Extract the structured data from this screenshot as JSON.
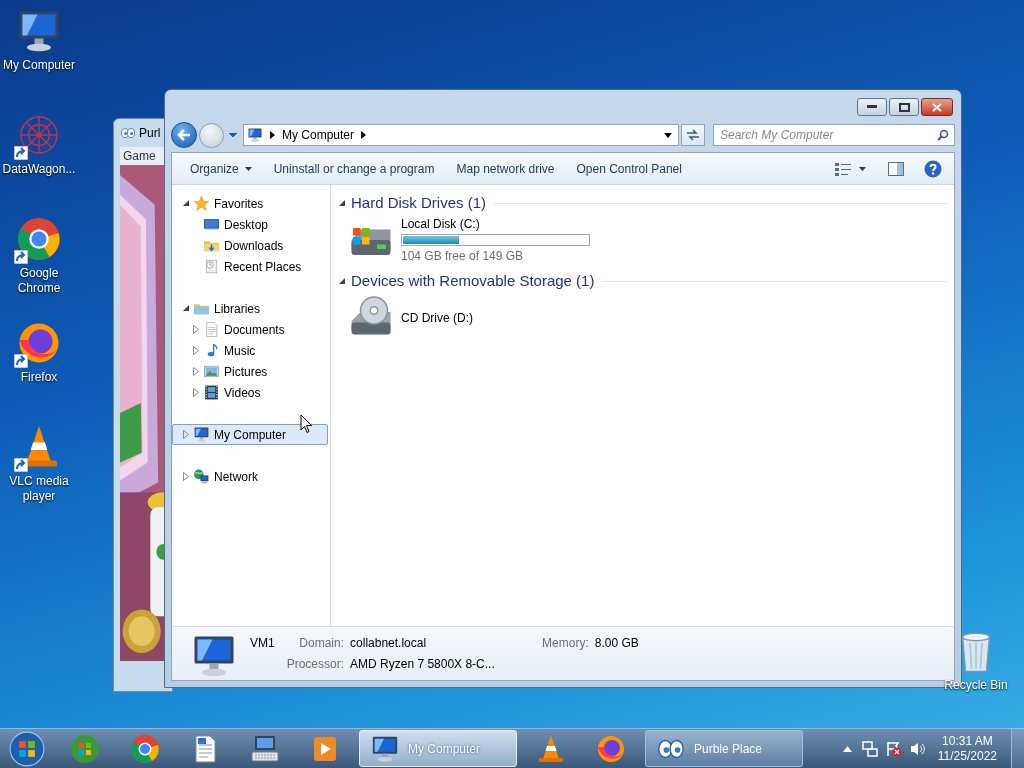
{
  "desktop_icons": [
    {
      "label": "My Computer",
      "kind": "computer",
      "shortcut": false
    },
    {
      "label": "DataWagon...",
      "kind": "datawagon",
      "shortcut": true
    },
    {
      "label": "Google Chrome",
      "kind": "chrome",
      "shortcut": true
    },
    {
      "label": "Firefox",
      "kind": "firefox",
      "shortcut": true
    },
    {
      "label": "VLC media player",
      "kind": "vlc",
      "shortcut": true
    }
  ],
  "recycle_bin": {
    "label": "Recycle Bin"
  },
  "back_window": {
    "title": "Purl",
    "menu": [
      "Game"
    ]
  },
  "explorer": {
    "address": [
      "My Computer"
    ],
    "search": {
      "placeholder": "Search My Computer"
    },
    "toolbar": [
      {
        "label": "Organize",
        "dropdown": true
      },
      {
        "label": "Uninstall or change a program",
        "dropdown": false
      },
      {
        "label": "Map network drive",
        "dropdown": false
      },
      {
        "label": "Open Control Panel",
        "dropdown": false
      }
    ],
    "nav": [
      {
        "label": "Favorites",
        "kind": "star",
        "expanded": true,
        "selected": false,
        "children": [
          {
            "label": "Desktop",
            "kind": "desktop",
            "selected": false
          },
          {
            "label": "Downloads",
            "kind": "downloads",
            "selected": false
          },
          {
            "label": "Recent Places",
            "kind": "recent",
            "selected": false
          }
        ]
      },
      {
        "label": "Libraries",
        "kind": "libraries",
        "expanded": true,
        "selected": false,
        "children": [
          {
            "label": "Documents",
            "kind": "documents",
            "expanded": false,
            "selected": false
          },
          {
            "label": "Music",
            "kind": "music",
            "expanded": false,
            "selected": false
          },
          {
            "label": "Pictures",
            "kind": "pictures",
            "expanded": false,
            "selected": false
          },
          {
            "label": "Videos",
            "kind": "videos",
            "expanded": false,
            "selected": false
          }
        ]
      },
      {
        "label": "My Computer",
        "kind": "computer",
        "expanded": false,
        "selected": true
      },
      {
        "label": "Network",
        "kind": "network",
        "expanded": false,
        "selected": false
      }
    ],
    "sections": [
      {
        "title": "Hard Disk Drives (1)",
        "expanded": true,
        "items": [
          {
            "name": "Local Disk (C:)",
            "kind": "hdd",
            "level": 0.3,
            "reading": "104 GB free of 149 GB"
          }
        ]
      },
      {
        "title": "Devices with Removable Storage (1)",
        "expanded": true,
        "items": [
          {
            "name": "CD Drive (D:)",
            "kind": "cd"
          }
        ]
      }
    ],
    "details": {
      "name": "VM1",
      "fields": [
        {
          "label": "Domain:",
          "value": "collabnet.local"
        },
        {
          "label": "Memory:",
          "value": "8.00 GB"
        },
        {
          "label": "Processor:",
          "value": "AMD Ryzen 7 5800X 8-C..."
        }
      ]
    }
  },
  "taskbar": {
    "items": [
      {
        "kind": "start",
        "selected": false
      },
      {
        "kind": "windows",
        "selected": false
      },
      {
        "kind": "chrome",
        "selected": false
      },
      {
        "kind": "wordpad",
        "selected": false
      },
      {
        "kind": "keyboard",
        "selected": false
      },
      {
        "kind": "media",
        "selected": false
      },
      {
        "kind": "computer",
        "label": "My Computer",
        "selected": true
      },
      {
        "kind": "vlc",
        "selected": false
      },
      {
        "kind": "firefox",
        "selected": false
      },
      {
        "kind": "eyes",
        "label": "Purble Place",
        "selected": false
      }
    ],
    "clock": {
      "time": "10:31 AM",
      "date": "11/25/2022"
    }
  }
}
